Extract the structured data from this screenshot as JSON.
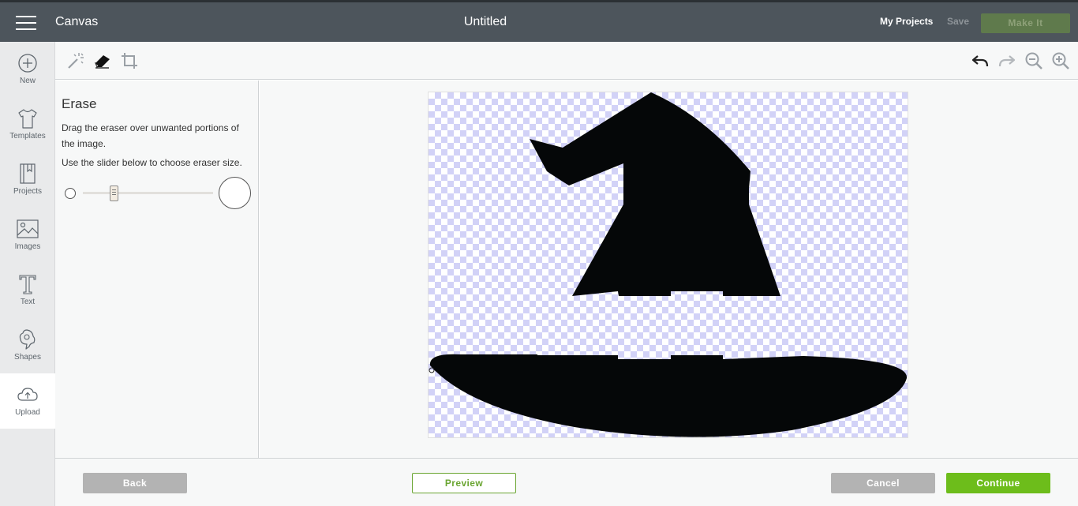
{
  "topbar": {
    "app_name": "Canvas",
    "title": "Untitled",
    "my_projects": "My Projects",
    "save": "Save",
    "make_it": "Make It"
  },
  "sidebar": {
    "items": [
      {
        "label": "New",
        "icon": "plus-circle-icon"
      },
      {
        "label": "Templates",
        "icon": "tshirt-icon"
      },
      {
        "label": "Projects",
        "icon": "notebook-icon"
      },
      {
        "label": "Images",
        "icon": "image-icon"
      },
      {
        "label": "Text",
        "icon": "text-icon"
      },
      {
        "label": "Shapes",
        "icon": "shapes-icon"
      },
      {
        "label": "Upload",
        "icon": "cloud-upload-icon"
      }
    ],
    "active": "Upload"
  },
  "toolbar": {
    "left_tools": [
      "magic-wand-icon",
      "eraser-icon",
      "crop-icon"
    ],
    "right_tools": [
      "undo-icon",
      "redo-icon",
      "zoom-out-icon",
      "zoom-in-icon"
    ]
  },
  "panel": {
    "title": "Erase",
    "instruction1": "Drag the eraser over unwanted portions of the image.",
    "instruction2": "Use the slider below to choose eraser size.",
    "eraser_size_fraction": 0.22
  },
  "footer": {
    "back": "Back",
    "preview": "Preview",
    "cancel": "Cancel",
    "continue": "Continue"
  },
  "colors": {
    "topbar": "#4d555c",
    "accent_green": "#6dbd1b",
    "checker": "#d2d2f7"
  }
}
